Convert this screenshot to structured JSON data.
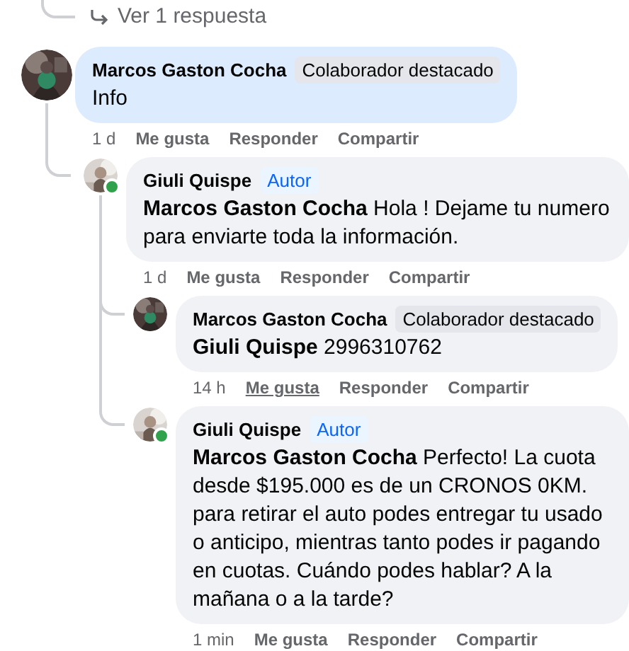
{
  "view_replies": {
    "label": "Ver 1 respuesta"
  },
  "comments": [
    {
      "author": "Marcos Gaston Cocha",
      "badge": {
        "label": "Colaborador destacado",
        "kind": "top-fan"
      },
      "text": "Info",
      "highlighted": true,
      "online": false,
      "time": "1 d",
      "actions": [
        {
          "label": "Me gusta",
          "hovered": false
        },
        {
          "label": "Responder",
          "hovered": false
        },
        {
          "label": "Compartir",
          "hovered": false
        }
      ],
      "children": [
        {
          "author": "Giuli Quispe",
          "badge": {
            "label": "Autor",
            "kind": "author"
          },
          "mention": "Marcos Gaston Cocha",
          "text": "Hola ! Dejame tu numero para enviarte toda la información.",
          "highlighted": false,
          "online": true,
          "time": "1 d",
          "actions": [
            {
              "label": "Me gusta",
              "hovered": false
            },
            {
              "label": "Responder",
              "hovered": false
            },
            {
              "label": "Compartir",
              "hovered": false
            }
          ],
          "children": [
            {
              "author": "Marcos Gaston Cocha",
              "badge": {
                "label": "Colaborador destacado",
                "kind": "top-fan"
              },
              "mention": "Giuli Quispe",
              "text": "2996310762",
              "highlighted": false,
              "online": false,
              "time": "14 h",
              "actions": [
                {
                  "label": "Me gusta",
                  "hovered": true
                },
                {
                  "label": "Responder",
                  "hovered": false
                },
                {
                  "label": "Compartir",
                  "hovered": false
                }
              ]
            },
            {
              "author": "Giuli Quispe",
              "badge": {
                "label": "Autor",
                "kind": "author"
              },
              "mention": "Marcos Gaston Cocha",
              "text": "Perfecto! La cuota desde $195.000 es de un CRONOS 0KM. para retirar el auto podes entregar tu usado o anticipo, mientras tanto podes ir pagando en cuotas. Cuándo podes hablar? A la mañana o a la tarde?",
              "highlighted": false,
              "online": true,
              "time": "1 min",
              "actions": [
                {
                  "label": "Me gusta",
                  "hovered": false
                },
                {
                  "label": "Responder",
                  "hovered": false
                },
                {
                  "label": "Compartir",
                  "hovered": false
                }
              ]
            }
          ]
        }
      ]
    }
  ]
}
